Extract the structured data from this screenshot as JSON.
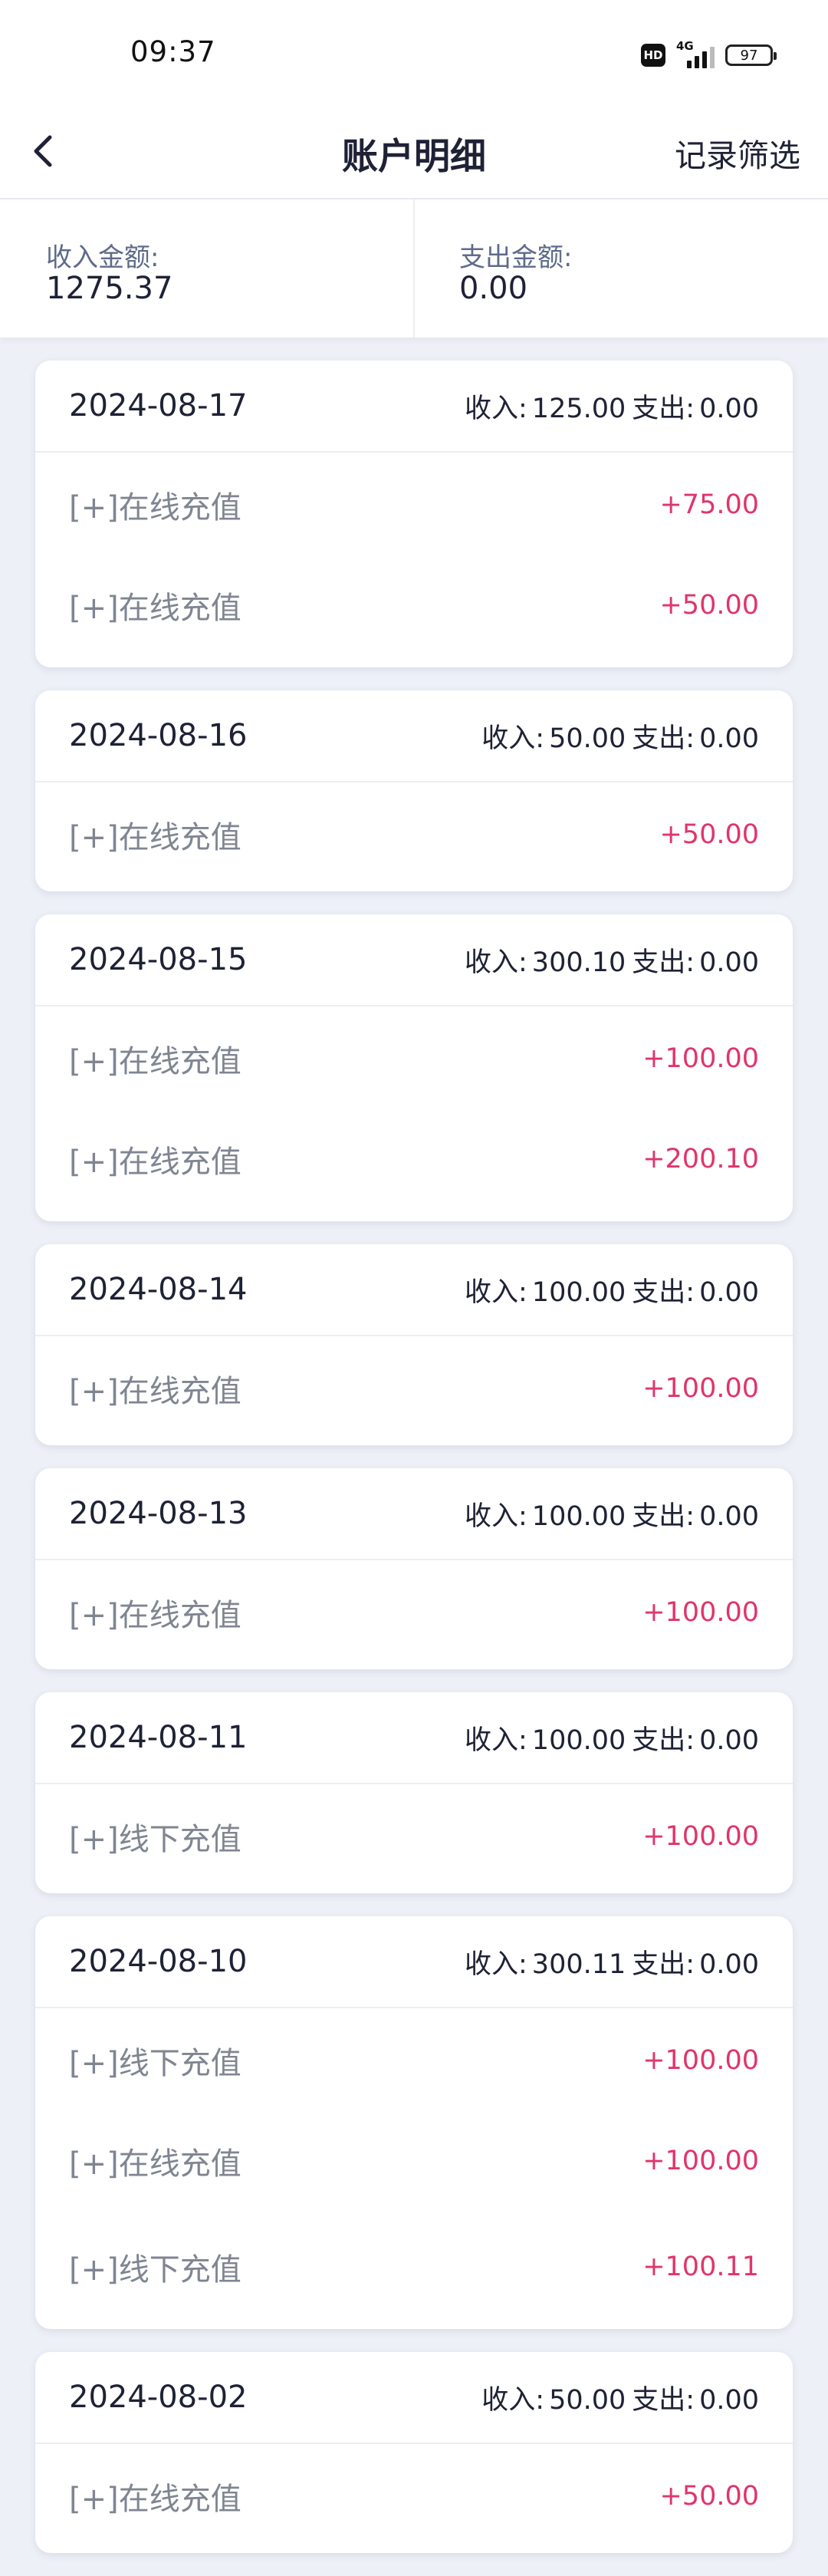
{
  "status": {
    "time": "09:37",
    "hd": "HD",
    "network": "4G",
    "battery": "97"
  },
  "header": {
    "title": "账户明细",
    "filter_label": "记录筛选"
  },
  "summary": {
    "income_label": "收入金额:",
    "income_value": "1275.37",
    "expense_label": "支出金额:",
    "expense_value": "0.00"
  },
  "labels": {
    "income_prefix": "收入:",
    "expense_prefix": "支出:"
  },
  "days": [
    {
      "date": "2024-08-17",
      "income": "125.00",
      "expense": "0.00",
      "items": [
        {
          "name": "[+]在线充值",
          "amount": "+75.00"
        },
        {
          "name": "[+]在线充值",
          "amount": "+50.00"
        }
      ]
    },
    {
      "date": "2024-08-16",
      "income": "50.00",
      "expense": "0.00",
      "items": [
        {
          "name": "[+]在线充值",
          "amount": "+50.00"
        }
      ]
    },
    {
      "date": "2024-08-15",
      "income": "300.10",
      "expense": "0.00",
      "items": [
        {
          "name": "[+]在线充值",
          "amount": "+100.00"
        },
        {
          "name": "[+]在线充值",
          "amount": "+200.10"
        }
      ]
    },
    {
      "date": "2024-08-14",
      "income": "100.00",
      "expense": "0.00",
      "items": [
        {
          "name": "[+]在线充值",
          "amount": "+100.00"
        }
      ]
    },
    {
      "date": "2024-08-13",
      "income": "100.00",
      "expense": "0.00",
      "items": [
        {
          "name": "[+]在线充值",
          "amount": "+100.00"
        }
      ]
    },
    {
      "date": "2024-08-11",
      "income": "100.00",
      "expense": "0.00",
      "items": [
        {
          "name": "[+]线下充值",
          "amount": "+100.00"
        }
      ]
    },
    {
      "date": "2024-08-10",
      "income": "300.11",
      "expense": "0.00",
      "items": [
        {
          "name": "[+]线下充值",
          "amount": "+100.00"
        },
        {
          "name": "[+]在线充值",
          "amount": "+100.00"
        },
        {
          "name": "[+]线下充值",
          "amount": "+100.11"
        }
      ]
    },
    {
      "date": "2024-08-02",
      "income": "50.00",
      "expense": "0.00",
      "items": [
        {
          "name": "[+]在线充值",
          "amount": "+50.00"
        }
      ]
    }
  ],
  "colors": {
    "accent_amount": "#e0356b",
    "background": "#eef0f7"
  },
  "icons": {
    "back": "chevron-left-icon"
  }
}
